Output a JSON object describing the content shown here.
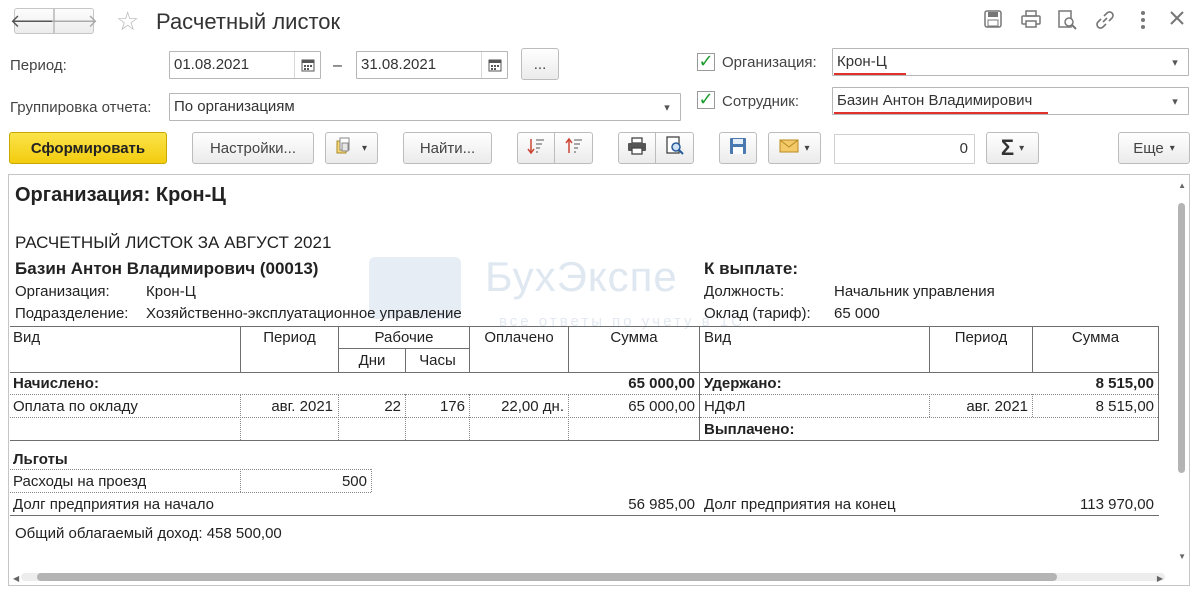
{
  "window": {
    "title": "Расчетный листок"
  },
  "form": {
    "period_label": "Период:",
    "period_from": "01.08.2021",
    "period_dash": "–",
    "period_to": "31.08.2021",
    "period_more": "...",
    "grouping_label": "Группировка отчета:",
    "grouping_value": "По организациям",
    "org_label": "Организация:",
    "org_value": "Крон-Ц",
    "employee_label": "Сотрудник:",
    "employee_value": "Базин Антон Владимирович"
  },
  "toolbar": {
    "generate": "Сформировать",
    "settings": "Настройки...",
    "find": "Найти...",
    "sum_value": "0",
    "more": "Еще"
  },
  "report": {
    "org_heading": "Организация: Крон-Ц",
    "sheet_title": "РАСЧЕТНЫЙ ЛИСТОК ЗА АВГУСТ 2021",
    "employee": "Базин Антон Владимирович (00013)",
    "org_label": "Организация:",
    "org_value": "Крон-Ц",
    "dept_label": "Подразделение:",
    "dept_value": "Хозяйственно-эксплуатационное управление",
    "to_pay_label": "К выплате:",
    "position_label": "Должность:",
    "position_value": "Начальник управления",
    "salary_label": "Оклад (тариф):",
    "salary_value": "65 000",
    "watermark": "БухЭкспе",
    "watermark_sub": "все ответы по учету в 1С",
    "left_headers": {
      "kind": "Вид",
      "period": "Период",
      "working": "Рабочие",
      "days": "Дни",
      "hours": "Часы",
      "paid": "Оплачено",
      "sum": "Сумма"
    },
    "right_headers": {
      "kind": "Вид",
      "period": "Период",
      "sum": "Сумма"
    },
    "accrued_label": "Начислено:",
    "accrued_total": "65 000,00",
    "accrual_row": {
      "kind": "Оплата по окладу",
      "period": "авг. 2021",
      "days": "22",
      "hours": "176",
      "paid": "22,00 дн.",
      "sum": "65 000,00"
    },
    "withheld_label": "Удержано:",
    "withheld_total": "8 515,00",
    "withheld_row": {
      "kind": "НДФЛ",
      "period": "авг. 2021",
      "sum": "8 515,00"
    },
    "paid_out_label": "Выплачено:",
    "benefits_label": "Льготы",
    "benefit_row": {
      "kind": "Расходы на проезд",
      "value": "500"
    },
    "debt_start_label": "Долг предприятия на начало",
    "debt_start_value": "56 985,00",
    "debt_end_label": "Долг предприятия на конец",
    "debt_end_value": "113 970,00",
    "taxable_income": "Общий облагаемый доход: 458 500,00"
  }
}
